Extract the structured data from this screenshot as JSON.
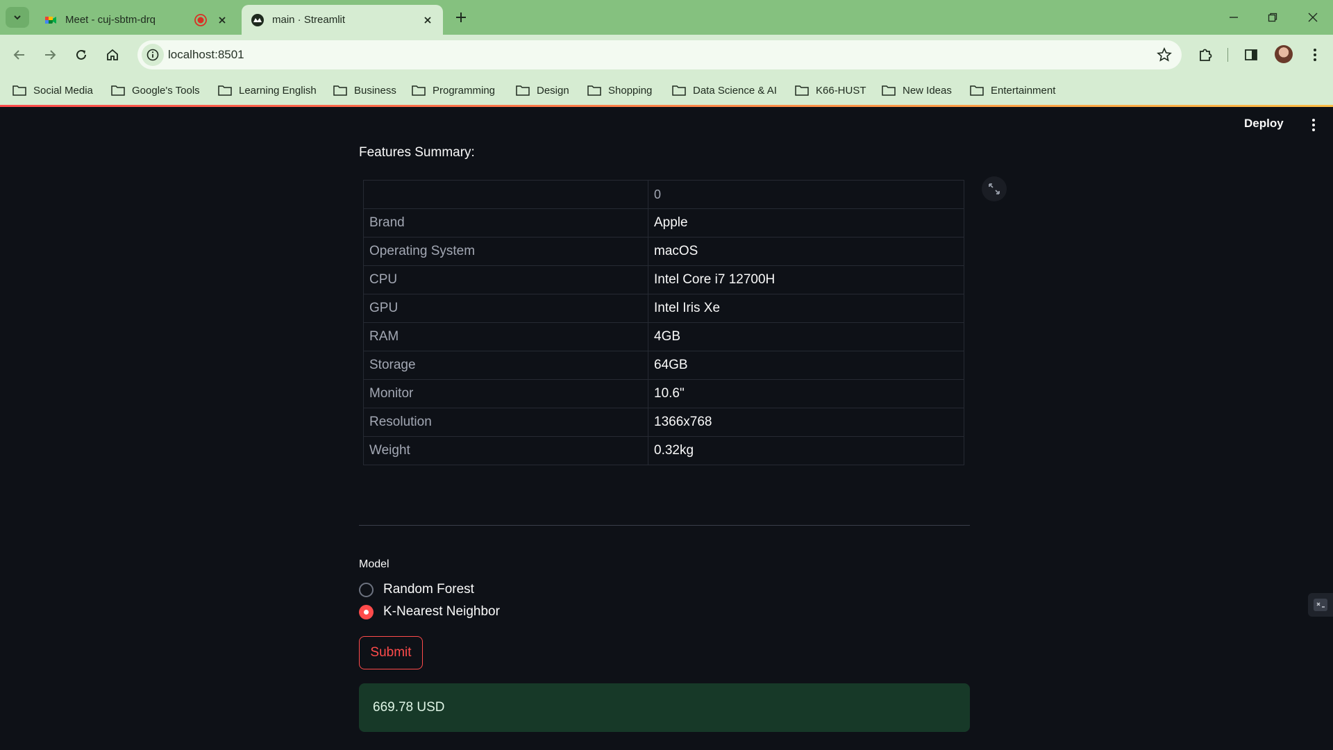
{
  "browser": {
    "tabs": [
      {
        "title": "Meet - cuj-sbtm-drq",
        "recording": true
      },
      {
        "title": "main · Streamlit",
        "active": true
      }
    ],
    "url": "localhost:8501",
    "bookmarks": [
      "Social Media",
      "Google's Tools",
      "Learning English",
      "Business",
      "Programming",
      "Design",
      "Shopping",
      "Data Science & AI",
      "K66-HUST",
      "New Ideas",
      "Entertainment"
    ]
  },
  "app": {
    "deploy_label": "Deploy",
    "summary_label": "Features Summary:",
    "table": {
      "column_header": "0",
      "rows": [
        {
          "feature": "Brand",
          "value": "Apple"
        },
        {
          "feature": "Operating System",
          "value": "macOS"
        },
        {
          "feature": "CPU",
          "value": "Intel Core i7 12700H"
        },
        {
          "feature": "GPU",
          "value": "Intel Iris Xe"
        },
        {
          "feature": "RAM",
          "value": "4GB"
        },
        {
          "feature": "Storage",
          "value": "64GB"
        },
        {
          "feature": "Monitor",
          "value": "10.6\""
        },
        {
          "feature": "Resolution",
          "value": "1366x768"
        },
        {
          "feature": "Weight",
          "value": "0.32kg"
        }
      ]
    },
    "model": {
      "label": "Model",
      "options": [
        "Random Forest",
        "K-Nearest Neighbor"
      ],
      "selected": "K-Nearest Neighbor"
    },
    "submit_label": "Submit",
    "result": "669.78 USD"
  },
  "colors": {
    "accent": "#ff4b4b",
    "background": "#0e1117",
    "success_bg": "#173928",
    "chrome_frame": "#85c17f",
    "chrome_toolbar": "#d6ecd2"
  },
  "icons": {
    "tab_search": "chevron-down-icon",
    "back": "arrow-left-icon",
    "forward": "arrow-right-icon",
    "reload": "reload-icon",
    "home": "home-icon",
    "site_info": "info-icon",
    "bookmark_star": "star-icon",
    "extensions": "puzzle-icon",
    "side_panel": "side-panel-icon",
    "menu": "kebab-icon",
    "bookmark_folder": "folder-icon",
    "fullscreen": "expand-icon"
  }
}
